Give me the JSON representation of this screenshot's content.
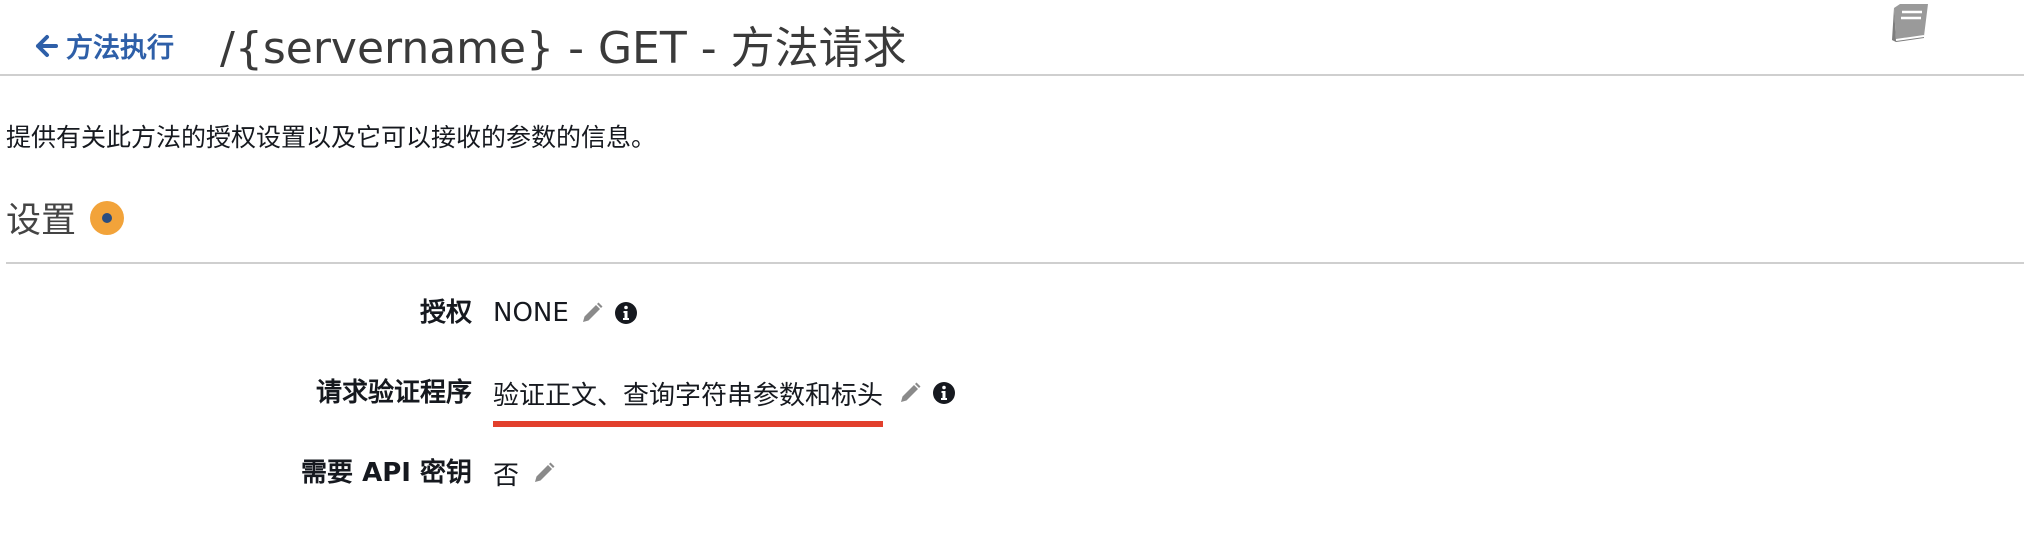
{
  "header": {
    "back_label": "方法执行",
    "title": "/{servername} - GET - 方法请求"
  },
  "description": "提供有关此方法的授权设置以及它可以接收的参数的信息。",
  "settings": {
    "title": "设置",
    "badge_color": "#f2a33a",
    "rows": [
      {
        "label": "授权",
        "value": "NONE",
        "icons": [
          "pencil-icon",
          "info-icon"
        ]
      },
      {
        "label": "请求验证程序",
        "value": "验证正文、查询字符串参数和标头",
        "icons": [
          "pencil-icon",
          "info-icon"
        ],
        "highlight_color": "#e2402c"
      },
      {
        "label": "需要 API 密钥",
        "value": "否",
        "icons": [
          "pencil-icon"
        ]
      }
    ]
  },
  "colors": {
    "link": "#2e5fa8",
    "divider": "#cfcfcf"
  },
  "icons": {
    "back": "arrow-left-icon",
    "docs": "book-icon"
  }
}
